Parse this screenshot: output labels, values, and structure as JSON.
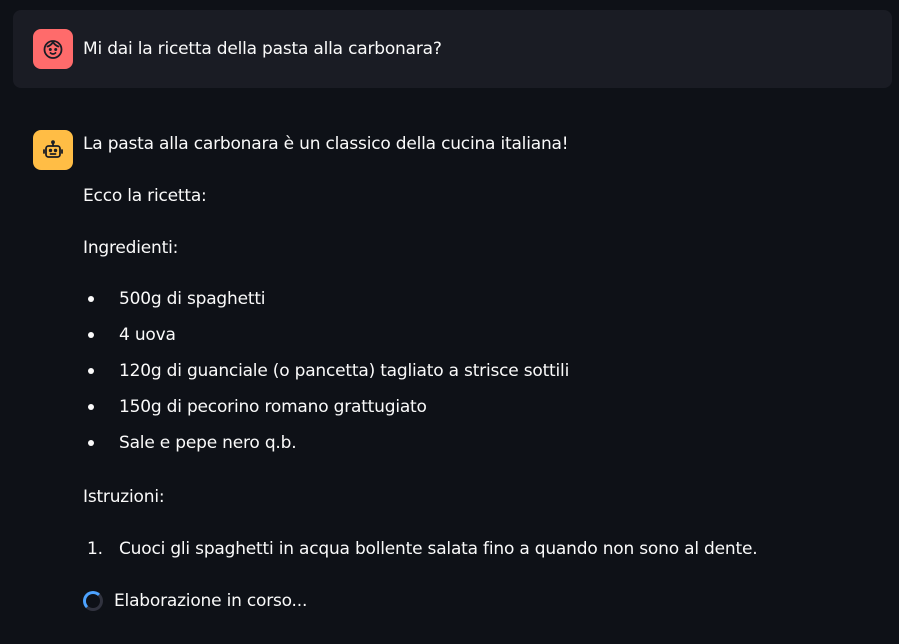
{
  "user_message": {
    "avatar_icon": "user-face-icon",
    "avatar_color": "#ff6b6b",
    "text": "Mi dai la ricetta della pasta alla carbonara?"
  },
  "assistant_message": {
    "avatar_icon": "robot-icon",
    "avatar_color": "#ffbd45",
    "intro": "La pasta alla carbonara è un classico della cucina italiana!",
    "recipe_intro": "Ecco la ricetta:",
    "ingredients_heading": "Ingredienti:",
    "ingredients": [
      "500g di spaghetti",
      "4 uova",
      "120g di guanciale (o pancetta) tagliato a strisce sottili",
      "150g di pecorino romano grattugiato",
      "Sale e pepe nero q.b."
    ],
    "instructions_heading": "Istruzioni:",
    "steps": [
      {
        "number": "1.",
        "text": "Cuoci gli spaghetti in acqua bollente salata fino a quando non sono al dente."
      }
    ]
  },
  "status": {
    "icon": "spinner-icon",
    "text": "Elaborazione in corso...",
    "accent_color": "#4da3ff"
  },
  "colors": {
    "background": "#0e1117",
    "user_bubble": "#1a1c24",
    "text": "#fafafa"
  }
}
